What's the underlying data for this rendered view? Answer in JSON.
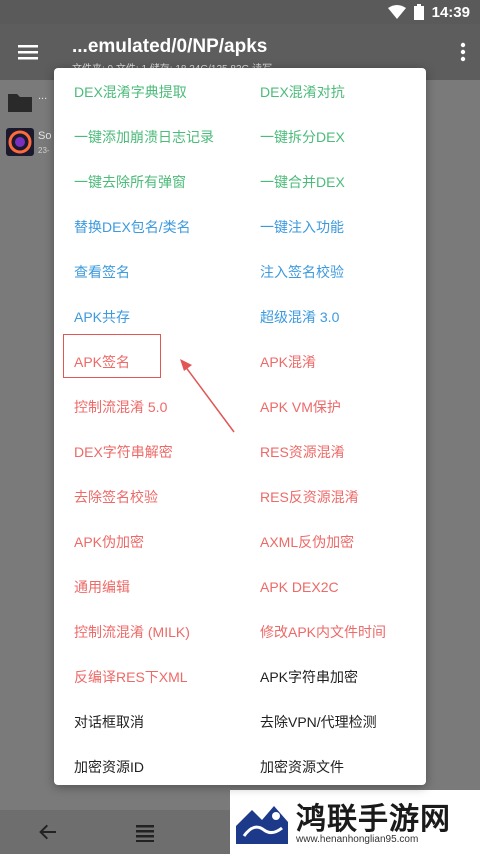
{
  "status_bar": {
    "time": "14:39"
  },
  "app_bar": {
    "title": "...emulated/0/NP/apks",
    "subtitle": "文件夹: 0  文件: 1  储存: 18.34G/125.83G    读写"
  },
  "file_list": [
    {
      "name": "...",
      "sub": ""
    },
    {
      "name": "So",
      "sub": "23-"
    }
  ],
  "colors": {
    "green": "#4cbb7a",
    "blue": "#3c9ade",
    "red": "#ec6a68",
    "black": "#212121"
  },
  "menu": {
    "rows": [
      {
        "left": {
          "label": "DEX混淆字典提取",
          "color": "green"
        },
        "right": {
          "label": "DEX混淆对抗",
          "color": "green"
        }
      },
      {
        "left": {
          "label": "一键添加崩溃日志记录",
          "color": "green"
        },
        "right": {
          "label": "一键拆分DEX",
          "color": "green"
        }
      },
      {
        "left": {
          "label": "一键去除所有弹窗",
          "color": "green"
        },
        "right": {
          "label": "一键合并DEX",
          "color": "green"
        }
      },
      {
        "left": {
          "label": "替换DEX包名/类名",
          "color": "blue"
        },
        "right": {
          "label": "一键注入功能",
          "color": "blue"
        }
      },
      {
        "left": {
          "label": "查看签名",
          "color": "blue"
        },
        "right": {
          "label": "注入签名校验",
          "color": "blue"
        }
      },
      {
        "left": {
          "label": "APK共存",
          "color": "blue"
        },
        "right": {
          "label": "超级混淆 3.0",
          "color": "blue"
        }
      },
      {
        "left": {
          "label": "APK签名",
          "color": "red"
        },
        "right": {
          "label": "APK混淆",
          "color": "red"
        }
      },
      {
        "left": {
          "label": "控制流混淆 5.0",
          "color": "red"
        },
        "right": {
          "label": "APK VM保护",
          "color": "red"
        }
      },
      {
        "left": {
          "label": "DEX字符串解密",
          "color": "red"
        },
        "right": {
          "label": "RES资源混淆",
          "color": "red"
        }
      },
      {
        "left": {
          "label": "去除签名校验",
          "color": "red"
        },
        "right": {
          "label": "RES反资源混淆",
          "color": "red"
        }
      },
      {
        "left": {
          "label": "APK伪加密",
          "color": "red"
        },
        "right": {
          "label": "AXML反伪加密",
          "color": "red"
        }
      },
      {
        "left": {
          "label": "通用编辑",
          "color": "red"
        },
        "right": {
          "label": "APK DEX2C",
          "color": "red"
        }
      },
      {
        "left": {
          "label": "控制流混淆 (MILK)",
          "color": "red"
        },
        "right": {
          "label": "修改APK内文件时间",
          "color": "red"
        }
      },
      {
        "left": {
          "label": "反编译RES下XML",
          "color": "red"
        },
        "right": {
          "label": "APK字符串加密",
          "color": "black"
        }
      },
      {
        "left": {
          "label": "对话框取消",
          "color": "black"
        },
        "right": {
          "label": "去除VPN/代理检测",
          "color": "black"
        }
      },
      {
        "left": {
          "label": "加密资源ID",
          "color": "black"
        },
        "right": {
          "label": "加密资源文件",
          "color": "black"
        }
      }
    ]
  },
  "watermark": {
    "title": "鸿联手游网",
    "url": "www.henanhonglian95.com"
  }
}
